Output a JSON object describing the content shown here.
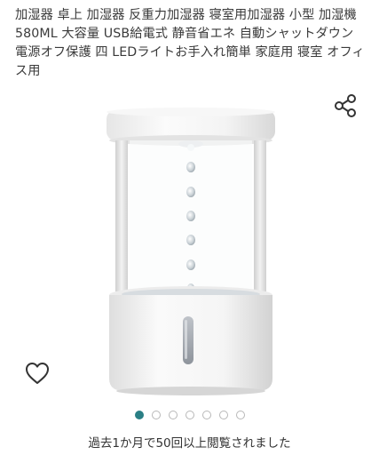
{
  "product": {
    "title": "加湿器 卓上 加湿器 反重力加湿器 寝室用加湿器 小型 加湿機 580ML 大容量 USB給電式 静音省エネ 自動シャットダウン 電源オフ保護 四 LEDライトお手入れ簡単 家庭用 寝室 オフィス用",
    "image_icon": "anti-gravity-humidifier-photo"
  },
  "actions": {
    "share_icon": "share-icon",
    "favorite_icon": "heart-outline-icon"
  },
  "carousel": {
    "total": 7,
    "active": 0,
    "active_color": "#2a7f85",
    "inactive_color": "#b8b8b8"
  },
  "views_text": "過去1か月で50回以上閲覧されました"
}
